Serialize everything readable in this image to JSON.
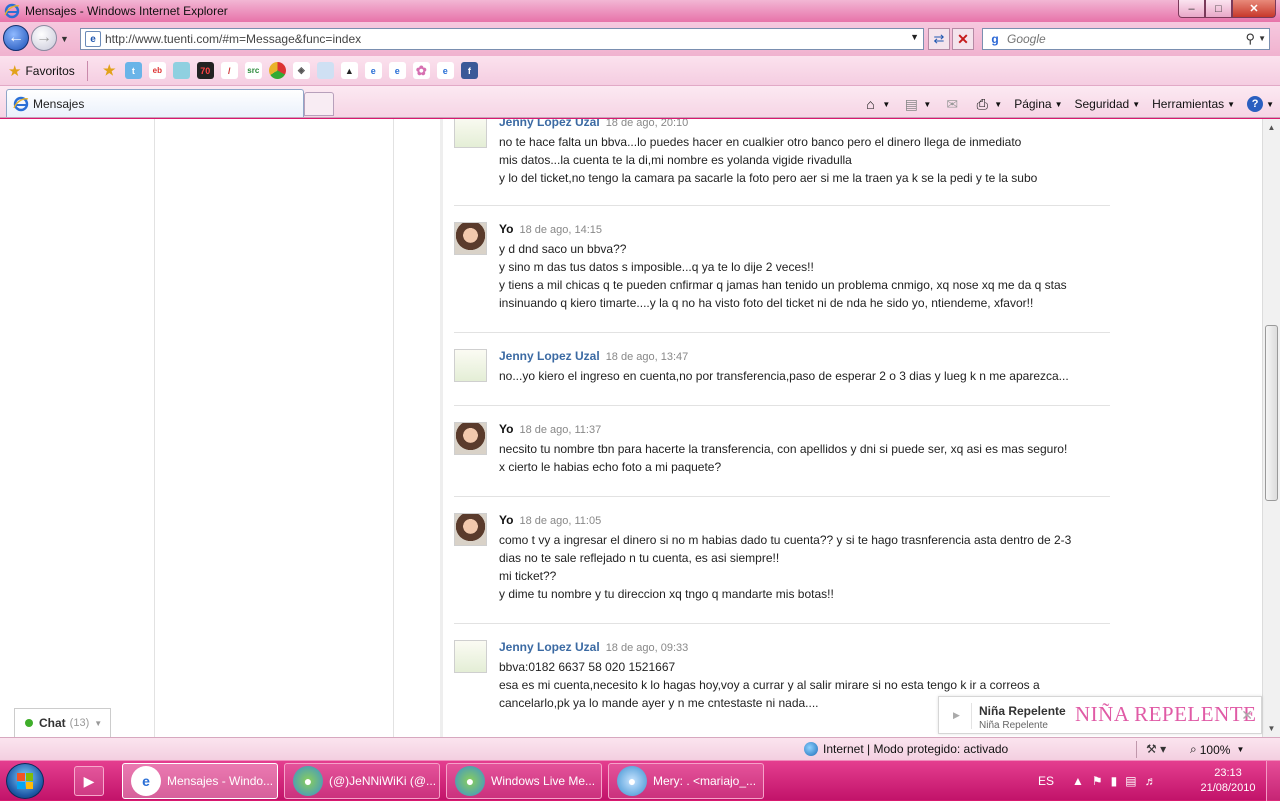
{
  "window": {
    "title": "Mensajes - Windows Internet Explorer",
    "min_label": "–",
    "max_label": "□",
    "close_label": "✕"
  },
  "address": {
    "url": "http://www.tuenti.com/#m=Message&func=index",
    "search_placeholder": "Google"
  },
  "favorites": {
    "label": "Favoritos",
    "icons": [
      "add-favorite-icon",
      "twitter-icon",
      "ebay-icon",
      "monitor-icon",
      "seventy-icon",
      "stripe-icon",
      "src-icon",
      "chrome-icon",
      "sheep-icon",
      "window-icon",
      "hat-icon",
      "ie-icon",
      "ie-icon",
      "ie-icon",
      "flower-icon",
      "ie-icon",
      "facebook-icon"
    ]
  },
  "tab": {
    "label": "Mensajes"
  },
  "commandbar": {
    "page": "Página",
    "security": "Seguridad",
    "tools": "Herramientas"
  },
  "messages": [
    {
      "author": "Jenny Lopez Uzal",
      "date": "18 de ago, 20:10",
      "who": "jenny",
      "lines": [
        "no te hace falta un bbva...lo puedes hacer en cualkier otro banco pero el dinero llega de inmediato",
        "mis datos...la cuenta te la di,mi nombre es yolanda vigide rivadulla",
        "y lo del ticket,no tengo la camara pa sacarle la foto pero aer si me la traen ya k se la pedi y te la subo"
      ]
    },
    {
      "author": "Yo",
      "date": "18 de ago, 14:15",
      "who": "yo",
      "lines": [
        "y d dnd saco un bbva??",
        "y sino m das tus datos s imposible...q ya te lo dije 2 veces!!",
        "y tiens a mil chicas q te pueden cnfirmar q jamas han tenido un problema cnmigo, xq nose xq me da q stas",
        "insinuando q kiero timarte....y la q no ha visto foto del ticket ni de nda he sido yo, ntiendeme, xfavor!!"
      ]
    },
    {
      "author": "Jenny Lopez Uzal",
      "date": "18 de ago, 13:47",
      "who": "jenny",
      "lines": [
        "no...yo kiero el ingreso en cuenta,no por transferencia,paso de esperar 2 o 3 dias y lueg k n me aparezca..."
      ]
    },
    {
      "author": "Yo",
      "date": "18 de ago, 11:37",
      "who": "yo",
      "lines": [
        "necsito tu nombre tbn para hacerte la transferencia, con apellidos y dni si puede ser, xq asi es mas seguro!",
        "x cierto le habias echo foto a mi paquete?"
      ]
    },
    {
      "author": "Yo",
      "date": "18 de ago, 11:05",
      "who": "yo",
      "lines": [
        "como t vy a ingresar el dinero si no m habias dado tu cuenta?? y si te hago trasnferencia asta dentro de 2-3",
        "dias no te sale reflejado n tu cuenta, es asi siempre!!",
        "mi ticket??",
        "y dime tu nombre y tu direccion xq tngo q mandarte mis botas!!"
      ]
    },
    {
      "author": "Jenny Lopez Uzal",
      "date": "18 de ago, 09:33",
      "who": "jenny",
      "lines": [
        "bbva:0182 6637 58 020 1521667",
        "esa es mi cuenta,necesito k lo hagas hoy,voy a currar y al salir mirare si no esta tengo k ir a correos a",
        "cancelarlo,pk ya lo mande ayer y n me cntestaste ni nada...."
      ]
    }
  ],
  "chat": {
    "label": "Chat",
    "count": "(13)"
  },
  "notification": {
    "title": "Niña Repelente",
    "subtitle": "Niña Repelente",
    "logo_text": "NIÑA REPELENTE"
  },
  "status": {
    "zone": "Internet | Modo protegido: activado",
    "zoom": "100%"
  },
  "taskbar": {
    "buttons": [
      {
        "label": "Mensajes - Windo...",
        "icon": "ie-icon",
        "active": true
      },
      {
        "label": "(@)JeNNiWiKi (@...",
        "icon": "messenger-icon",
        "active": false
      },
      {
        "label": "Windows Live Me...",
        "icon": "messenger-icon",
        "active": false
      },
      {
        "label": "Mery: . <mariajo_...",
        "icon": "messenger-user-icon",
        "active": false
      }
    ],
    "lang": "ES",
    "time": "23:13",
    "date": "21/08/2010"
  },
  "colors": {
    "taskbar": "#d9186f",
    "link_blue": "#3b6aa3",
    "online_green": "#3fae2a"
  }
}
